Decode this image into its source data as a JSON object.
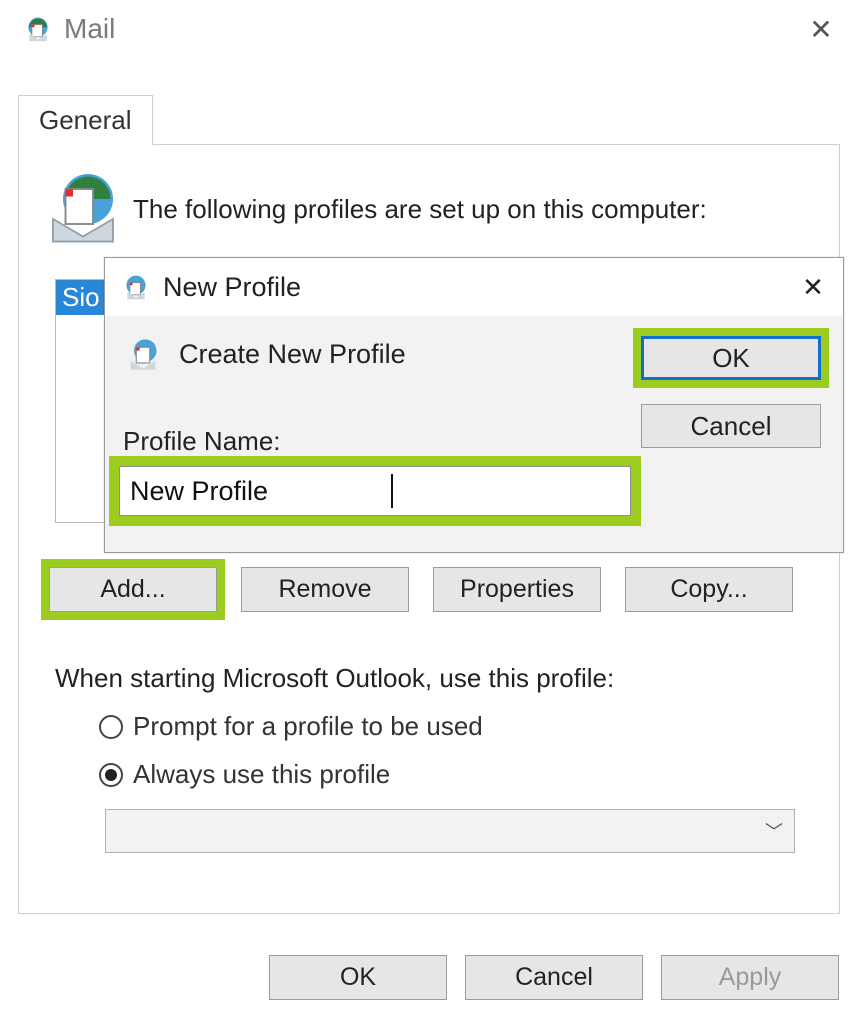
{
  "window": {
    "title": "Mail"
  },
  "tab": {
    "label": "General"
  },
  "panel": {
    "intro": "The following profiles are set up on this computer:",
    "selected_profile": "Sio",
    "buttons": {
      "add": "Add...",
      "remove": "Remove",
      "properties": "Properties",
      "copy": "Copy..."
    },
    "startup_text": "When starting Microsoft Outlook, use this profile:",
    "radios": {
      "prompt": "Prompt for a profile to be used",
      "always": "Always use this profile"
    },
    "dropdown_value": ""
  },
  "bottom": {
    "ok": "OK",
    "cancel": "Cancel",
    "apply": "Apply"
  },
  "dialog": {
    "title": "New Profile",
    "heading": "Create New Profile",
    "name_label": "Profile Name:",
    "name_value": "New Profile",
    "ok": "OK",
    "cancel": "Cancel"
  }
}
